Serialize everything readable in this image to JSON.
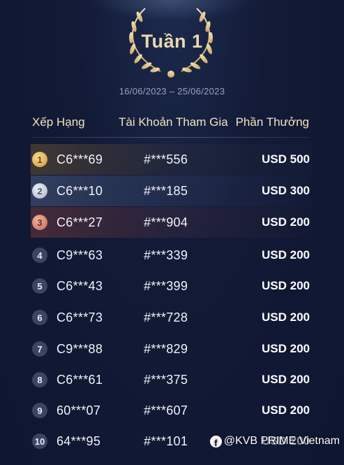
{
  "leaderboard": {
    "week_title": "Tuần 1",
    "date_range": "16/06/2023 – 25/06/2023",
    "headers": {
      "rank": "Xếp Hạng",
      "account": "Tài Khoản Tham Gia",
      "reward": "Phần Thưởng"
    },
    "rows": [
      {
        "rank": "1",
        "id": "C6***69",
        "account": "#***556",
        "reward": "USD 500"
      },
      {
        "rank": "2",
        "id": "C6***10",
        "account": "#***185",
        "reward": "USD 300"
      },
      {
        "rank": "3",
        "id": "C6***27",
        "account": "#***904",
        "reward": "USD 200"
      },
      {
        "rank": "4",
        "id": "C9***63",
        "account": "#***339",
        "reward": "USD 200"
      },
      {
        "rank": "5",
        "id": "C6***43",
        "account": "#***399",
        "reward": "USD 200"
      },
      {
        "rank": "6",
        "id": "C6***73",
        "account": "#***728",
        "reward": "USD 200"
      },
      {
        "rank": "7",
        "id": "C9***88",
        "account": "#***829",
        "reward": "USD 200"
      },
      {
        "rank": "8",
        "id": "C6***61",
        "account": "#***375",
        "reward": "USD 200"
      },
      {
        "rank": "9",
        "id": "60***07",
        "account": "#***607",
        "reward": "USD 200"
      },
      {
        "rank": "10",
        "id": "64***95",
        "account": "#***101",
        "reward": "USD 200"
      }
    ]
  },
  "watermark": {
    "icon": "facebook-icon",
    "text": "@KVB PRIME Vietnam"
  },
  "colors": {
    "background": "#121a36",
    "gold_accent": "#e9d9b1",
    "header_text": "#f1e4c3"
  }
}
